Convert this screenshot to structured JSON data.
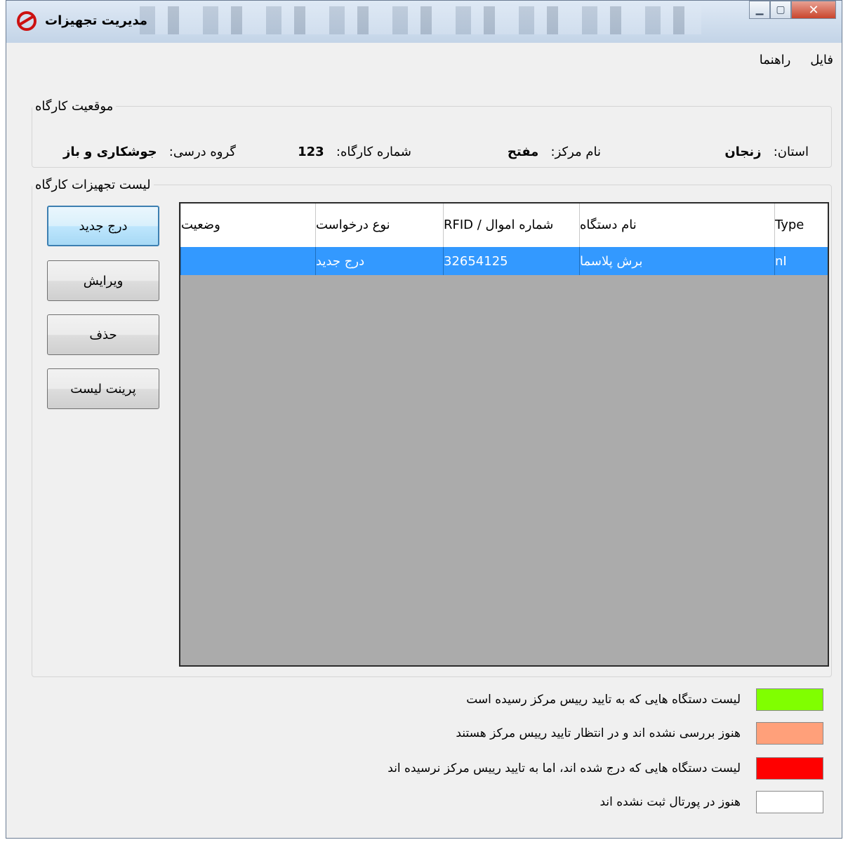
{
  "window": {
    "title": "مدیریت تجهیزات",
    "colors": {
      "titlebar": "#c3d4e7",
      "close": "#c9452d"
    }
  },
  "menu": [
    {
      "label": "فایل"
    },
    {
      "label": "راهنما"
    }
  ],
  "location": {
    "group_title": "موقعیت کارگاه",
    "province_label": "استان:",
    "province_value": "زنجان",
    "center_label": "نام مرکز:",
    "center_value": "مفتح",
    "workshop_label": "شماره کارگاه:",
    "workshop_value": "123",
    "course_label": "گروه درسی:",
    "course_value": "جوشکاری و باز"
  },
  "equipment": {
    "group_title": "لیست تجهیزات کارگاه",
    "columns": [
      "Type",
      "نام دستگاه",
      "شماره اموال / RFID",
      "نوع درخواست",
      "وضعیت"
    ],
    "rows": [
      {
        "type": "nI",
        "device": "برش پلاسما",
        "rfid": "32654125",
        "request": "درج جدید",
        "status": ""
      }
    ],
    "selection_color": "#3399ff",
    "empty_area_color": "#ababab"
  },
  "buttons": {
    "insert": "درج جدید",
    "edit": "ویرایش",
    "delete": "حذف",
    "print": "پرینت لیست"
  },
  "legend": [
    {
      "color": "#80ff00",
      "text": "لیست دستگاه هایی که به تایید رییس مرکز رسیده است"
    },
    {
      "color": "#ffa07a",
      "text": "هنوز بررسی نشده اند و در انتظار تایید رییس مرکز هستند"
    },
    {
      "color": "#ff0000",
      "text": "لیست دستگاه هایی که درج شده اند، اما به تایید رییس مرکز نرسیده اند"
    },
    {
      "color": "#ffffff",
      "text": "هنوز در پورتال ثبت نشده اند"
    }
  ]
}
